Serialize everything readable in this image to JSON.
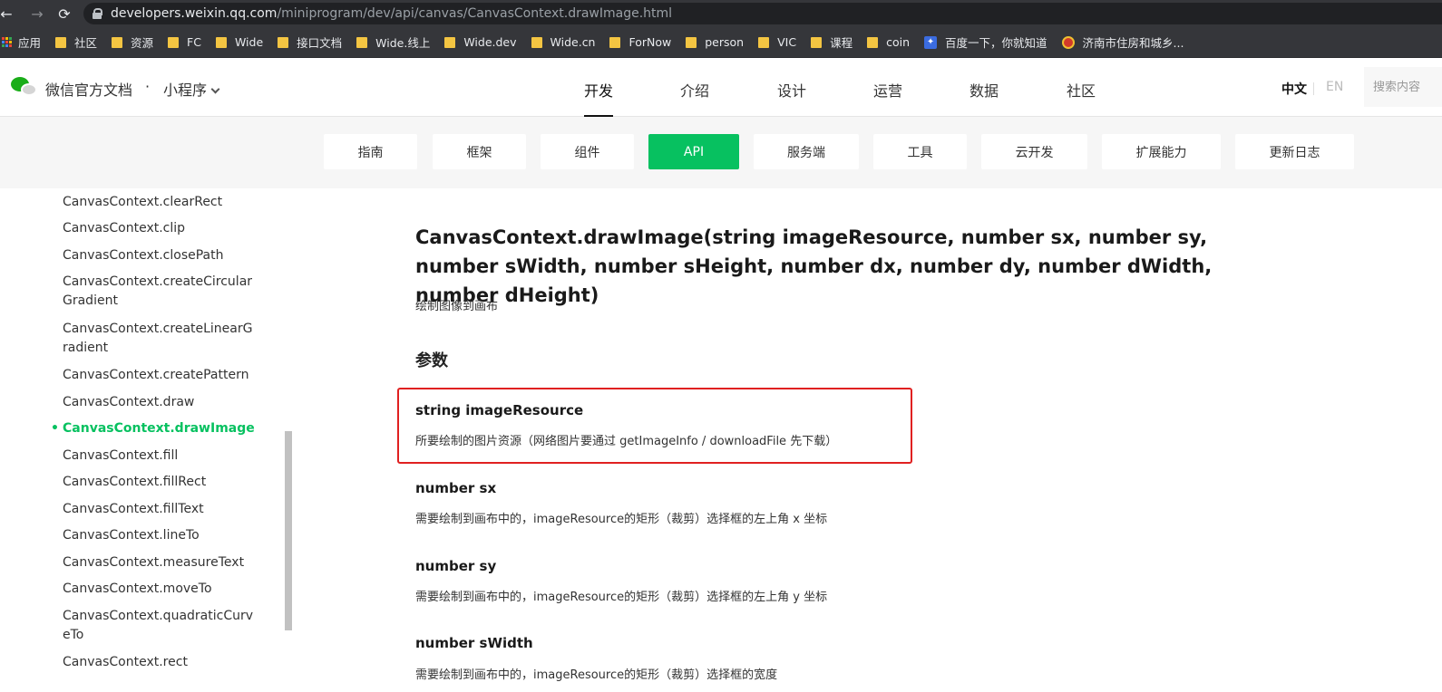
{
  "browser": {
    "url_host": "developers.weixin.qq.com",
    "url_path": "/miniprogram/dev/api/canvas/CanvasContext.drawImage.html",
    "bookmarks": [
      "应用",
      "社区",
      "资源",
      "FC",
      "Wide",
      "接口文档",
      "Wide.线上",
      "Wide.dev",
      "Wide.cn",
      "ForNow",
      "person",
      "VIC",
      "课程",
      "coin",
      "百度一下，你就知道",
      "济南市住房和城乡..."
    ]
  },
  "header": {
    "brand": "微信官方文档",
    "dot": "·",
    "product": "小程序",
    "nav": [
      "开发",
      "介绍",
      "设计",
      "运营",
      "数据",
      "社区"
    ],
    "active_nav": "开发",
    "lang_cn": "中文",
    "lang_en": "EN",
    "search_placeholder": "搜索内容"
  },
  "subtabs": [
    "指南",
    "框架",
    "组件",
    "API",
    "服务端",
    "工具",
    "云开发",
    "扩展能力",
    "更新日志"
  ],
  "active_subtab": "API",
  "sidebar": {
    "items": [
      "CanvasContext.clearRect",
      "CanvasContext.clip",
      "CanvasContext.closePath",
      "CanvasContext.createCircularGradient",
      "CanvasContext.createLinearGradient",
      "CanvasContext.createPattern",
      "CanvasContext.draw",
      "CanvasContext.drawImage",
      "CanvasContext.fill",
      "CanvasContext.fillRect",
      "CanvasContext.fillText",
      "CanvasContext.lineTo",
      "CanvasContext.measureText",
      "CanvasContext.moveTo",
      "CanvasContext.quadraticCurveTo",
      "CanvasContext.rect"
    ],
    "active_item": "CanvasContext.drawImage"
  },
  "content": {
    "title": "CanvasContext.drawImage(string imageResource, number sx, number sy, number sWidth, number sHeight, number dx, number dy, number dWidth, number dHeight)",
    "description": "绘制图像到画布",
    "params_heading": "参数",
    "params": [
      {
        "name": "string imageResource",
        "desc": "所要绘制的图片资源（网络图片要通过 getImageInfo / downloadFile 先下载）"
      },
      {
        "name": "number sx",
        "desc": "需要绘制到画布中的，imageResource的矩形（裁剪）选择框的左上角 x 坐标"
      },
      {
        "name": "number sy",
        "desc": "需要绘制到画布中的，imageResource的矩形（裁剪）选择框的左上角 y 坐标"
      },
      {
        "name": "number sWidth",
        "desc": "需要绘制到画布中的，imageResource的矩形（裁剪）选择框的宽度"
      }
    ]
  },
  "colors": {
    "accent": "#07c160",
    "highlight_border": "#e02020",
    "chrome_bg": "#35363a"
  }
}
